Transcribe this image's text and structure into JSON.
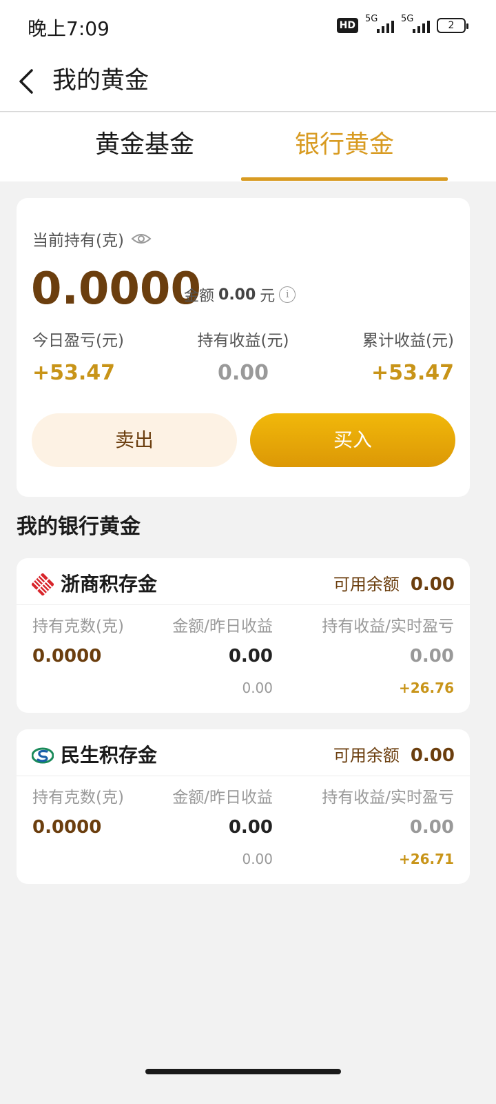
{
  "status_bar": {
    "time": "晚上7:09",
    "hd_label": "HD",
    "sim1_label": "5G",
    "sim2_label": "5G",
    "battery_level": "2"
  },
  "nav": {
    "title": "我的黄金",
    "back_icon": "chevron-left-icon"
  },
  "tabs": [
    {
      "label": "黄金基金",
      "active": false
    },
    {
      "label": "银行黄金",
      "active": true
    }
  ],
  "summary": {
    "hold_label": "当前持有(克)",
    "grams": "0.0000",
    "amount_prefix": "金额",
    "amount_value": "0.00",
    "amount_unit": "元",
    "stats": {
      "today_label": "今日盈亏(元)",
      "today_value": "+53.47",
      "hold_label": "持有收益(元)",
      "hold_value": "0.00",
      "total_label": "累计收益(元)",
      "total_value": "+53.47"
    },
    "sell_label": "卖出",
    "buy_label": "买入"
  },
  "section_title": "我的银行黄金",
  "banks": [
    {
      "name": "浙商积存金",
      "available_label": "可用余额",
      "available_value": "0.00",
      "col_grams_label": "持有克数(克)",
      "col_amount_label": "金额/昨日收益",
      "col_profit_label": "持有收益/实时盈亏",
      "grams": "0.0000",
      "amount": "0.00",
      "yesterday": "0.00",
      "hold_profit": "0.00",
      "realtime": "+26.76"
    },
    {
      "name": "民生积存金",
      "available_label": "可用余额",
      "available_value": "0.00",
      "col_grams_label": "持有克数(克)",
      "col_amount_label": "金额/昨日收益",
      "col_profit_label": "持有收益/实时盈亏",
      "grams": "0.0000",
      "amount": "0.00",
      "yesterday": "0.00",
      "hold_profit": "0.00",
      "realtime": "+26.71"
    }
  ],
  "colors": {
    "accent_gold": "#d89b22",
    "brown": "#6b3e0e",
    "profit_gold": "#c89418"
  }
}
